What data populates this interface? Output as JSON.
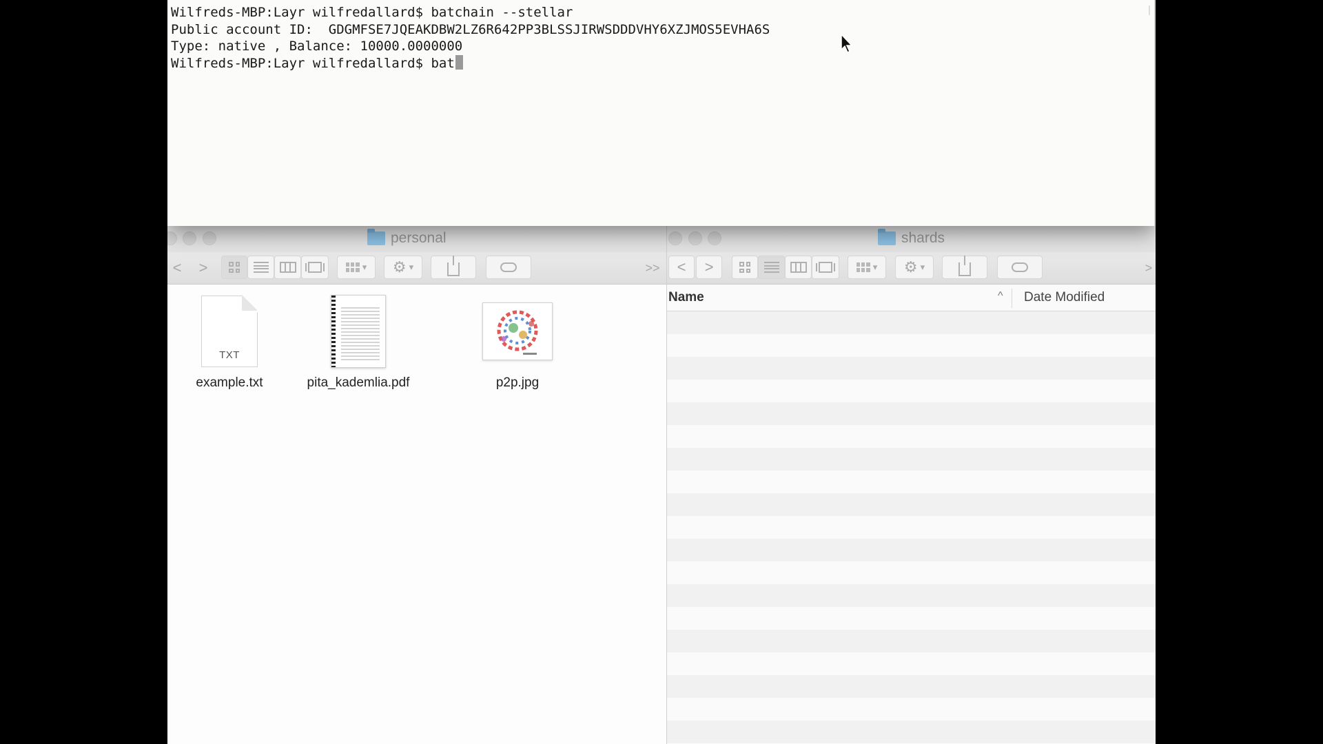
{
  "terminal": {
    "lines": [
      "Wilfreds-MBP:Layr wilfredallard$ batchain --stellar",
      "Public account ID:  GDGMFSE7JQEAKDBW2LZ6R642PP3BLSSJIRWSDDDVHY6XZJMOS5EVHA6S",
      "Type: native , Balance: 10000.0000000"
    ],
    "prompt_line": "Wilfreds-MBP:Layr wilfredallard$ bat"
  },
  "personal_window": {
    "title": "personal",
    "files": [
      {
        "name": "example.txt",
        "icon": "txt-file-icon",
        "badge": "TXT"
      },
      {
        "name": "pita_kademlia.pdf",
        "icon": "pdf-file-icon"
      },
      {
        "name": "p2p.jpg",
        "icon": "jpg-file-icon"
      }
    ]
  },
  "shards_window": {
    "title": "shards",
    "columns": {
      "name": "Name",
      "sort_indicator": "^",
      "date": "Date Modified"
    }
  },
  "toolbar": {
    "back": "<",
    "forward": ">",
    "overflow": ">>"
  },
  "colors": {
    "folder": "#8ec5ea",
    "terminal_bg": "#fbfbf9",
    "finder_bg": "#fdfdfd"
  }
}
